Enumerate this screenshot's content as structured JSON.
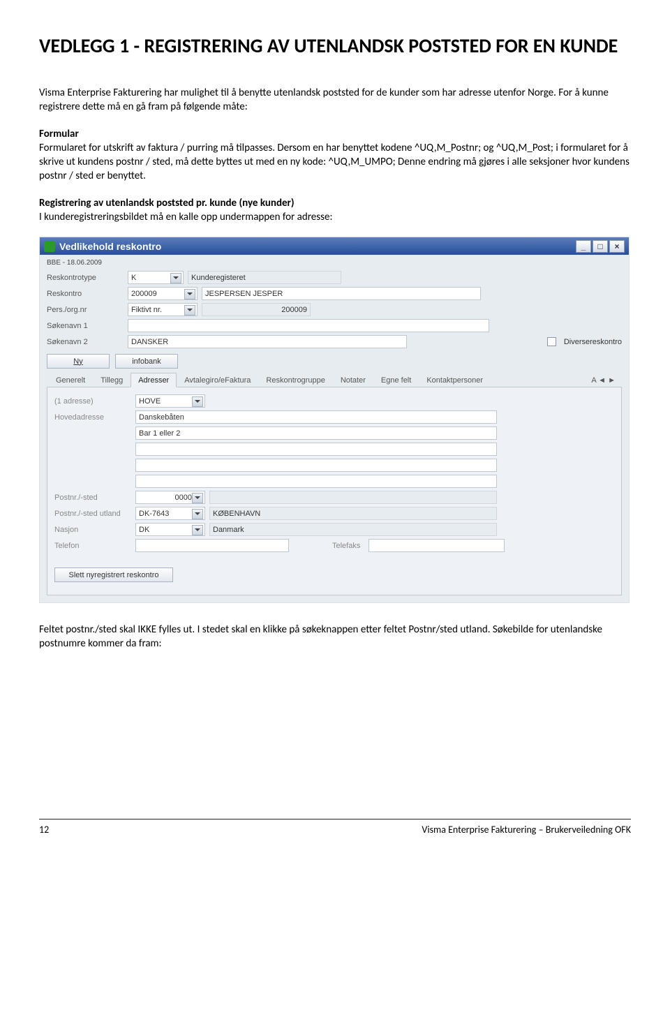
{
  "doc": {
    "title": "VEDLEGG 1 - REGISTRERING AV UTENLANDSK POSTSTED FOR EN KUNDE",
    "intro": "Visma Enterprise Fakturering har mulighet til å benytte utenlandsk poststed for de kunder som har adresse utenfor Norge. For å kunne registrere dette må en gå fram på følgende måte:",
    "formular_heading": "Formular",
    "formular_body": "Formularet for utskrift av faktura / purring må tilpasses. Dersom en har benyttet kodene ^UQ,M_Postnr; og ^UQ,M_Post; i formularet for å skrive ut kundens postnr / sted, må dette byttes ut med en ny kode: ^UQ,M_UMPO; Denne endring må gjøres i alle seksjoner hvor kundens postnr / sted er benyttet.",
    "reg_heading": "Registrering av utenlandsk poststed pr. kunde (nye kunder)",
    "reg_body": "I kunderegistreringsbildet må en kalle opp undermappen for adresse:",
    "after_img": "Feltet postnr./sted skal IKKE fylles ut. I stedet skal en klikke på søkeknappen etter feltet Postnr/sted utland.  Søkebilde for utenlandske postnumre kommer da fram:"
  },
  "app": {
    "title": "Vedlikehold reskontro",
    "date_line": "BBE - 18.06.2009",
    "labels": {
      "reskontrotype": "Reskontrotype",
      "reskontro": "Reskontro",
      "persorg": "Pers./org.nr",
      "sokenavn1": "Søkenavn 1",
      "sokenavn2": "Søkenavn 2",
      "diversereskontro": "Diversereskontro",
      "adr_count": "(1 adresse)",
      "hovedadresse": "Hovedadresse",
      "postnr_sted": "Postnr./-sted",
      "postnr_sted_utland": "Postnr./-sted utland",
      "nasjon": "Nasjon",
      "telefon": "Telefon",
      "telefaks": "Telefaks"
    },
    "values": {
      "reskontrotype_code": "K",
      "reskontrotype_desc": "Kunderegisteret",
      "reskontro_code": "200009",
      "reskontro_name": "JESPERSEN JESPER",
      "persorg_type": "Fiktivt nr.",
      "persorg_value": "200009",
      "sokenavn2": "DANSKER",
      "adr_code": "HOVE",
      "hovedadresse": "Danskebåten",
      "adr_line2": "Bar 1 eller 2",
      "postnr_sted_code": "0000",
      "postnr_utland_code": "DK-7643",
      "postnr_utland_city": "KØBENHAVN",
      "nasjon_code": "DK",
      "nasjon_name": "Danmark"
    },
    "buttons": {
      "ny": "Ny",
      "infobank": "infobank",
      "slett": "Slett nyregistrert reskontro"
    },
    "tabs": [
      "Generelt",
      "Tillegg",
      "Adresser",
      "Avtalegiro/eFaktura",
      "Reskontrogruppe",
      "Notater",
      "Egne felt",
      "Kontaktpersoner"
    ],
    "active_tab_index": 2,
    "tab_overflow": "A"
  },
  "footer": {
    "page": "12",
    "right": "Visma Enterprise Fakturering – Brukerveiledning OFK"
  }
}
